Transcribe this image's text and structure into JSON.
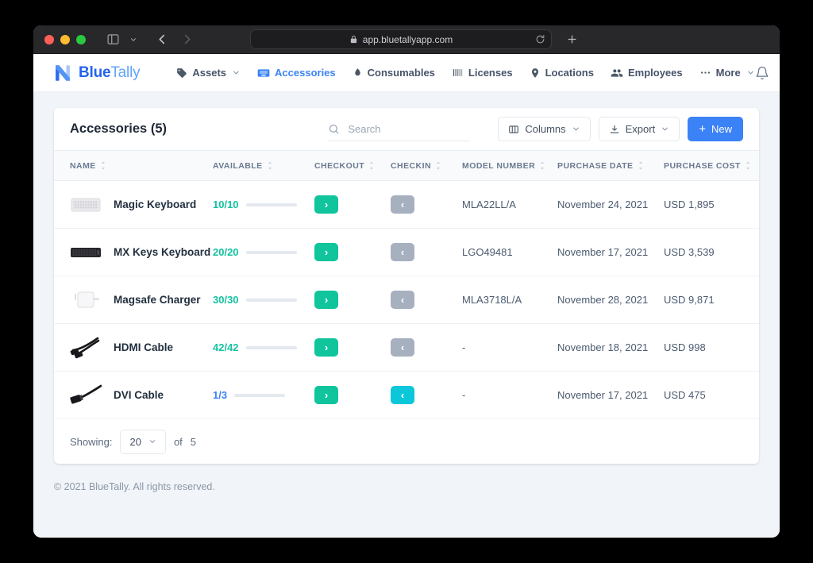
{
  "browser": {
    "url": "app.bluetallyapp.com"
  },
  "nav": {
    "logo_primary": "Blue",
    "logo_secondary": "Tally",
    "items": [
      {
        "label": "Assets",
        "icon": "tag-icon",
        "chevron": true,
        "active": false
      },
      {
        "label": "Accessories",
        "icon": "keyboard-icon",
        "chevron": false,
        "active": true
      },
      {
        "label": "Consumables",
        "icon": "droplet-icon",
        "chevron": false,
        "active": false
      },
      {
        "label": "Licenses",
        "icon": "barcode-icon",
        "chevron": false,
        "active": false
      },
      {
        "label": "Locations",
        "icon": "map-pin-icon",
        "chevron": false,
        "active": false
      },
      {
        "label": "Employees",
        "icon": "people-icon",
        "chevron": false,
        "active": false
      },
      {
        "label": "More",
        "icon": "ellipsis-icon",
        "chevron": true,
        "active": false
      }
    ]
  },
  "page": {
    "title": "Accessories (5)",
    "search_placeholder": "Search",
    "columns_label": "Columns",
    "export_label": "Export",
    "new_label": "New"
  },
  "table": {
    "headers": [
      "NAME",
      "AVAILABLE",
      "CHECKOUT",
      "CHECKIN",
      "MODEL NUMBER",
      "PURCHASE DATE",
      "PURCHASE COST"
    ],
    "rows": [
      {
        "name": "Magic Keyboard",
        "icon": "magic-keyboard-thumb",
        "available": "10/10",
        "available_pct": 100,
        "available_color": "green",
        "checkout_enabled": true,
        "checkin_enabled": false,
        "model_number": "MLA22LL/A",
        "purchase_date": "November 24, 2021",
        "purchase_cost": "USD 1,895"
      },
      {
        "name": "MX Keys Keyboard",
        "icon": "mx-keys-thumb",
        "available": "20/20",
        "available_pct": 100,
        "available_color": "green",
        "checkout_enabled": true,
        "checkin_enabled": false,
        "model_number": "LGO49481",
        "purchase_date": "November 17, 2021",
        "purchase_cost": "USD 3,539"
      },
      {
        "name": "Magsafe Charger",
        "icon": "magsafe-thumb",
        "available": "30/30",
        "available_pct": 100,
        "available_color": "green",
        "checkout_enabled": true,
        "checkin_enabled": false,
        "model_number": "MLA3718L/A",
        "purchase_date": "November 28, 2021",
        "purchase_cost": "USD 9,871"
      },
      {
        "name": "HDMI Cable",
        "icon": "hdmi-cable-thumb",
        "available": "42/42",
        "available_pct": 100,
        "available_color": "green",
        "checkout_enabled": true,
        "checkin_enabled": false,
        "model_number": "-",
        "purchase_date": "November 18, 2021",
        "purchase_cost": "USD 998"
      },
      {
        "name": "DVI Cable",
        "icon": "dvi-cable-thumb",
        "available": "1/3",
        "available_pct": 33,
        "available_color": "blue",
        "checkout_enabled": true,
        "checkin_enabled": true,
        "model_number": "-",
        "purchase_date": "November 17, 2021",
        "purchase_cost": "USD 475"
      }
    ]
  },
  "pagination": {
    "showing_label": "Showing:",
    "page_size": "20",
    "of_label": "of",
    "total": "5"
  },
  "footer": {
    "copyright": "© 2021 BlueTally. All rights reserved."
  },
  "colors": {
    "accent_blue": "#3b82f6",
    "checkout_green": "#10c49c",
    "checkin_cyan": "#0cc7da",
    "checkin_disabled": "#a7b0bf",
    "progress_blue": "#3b82f6",
    "progress_green": "#14c2a0"
  }
}
